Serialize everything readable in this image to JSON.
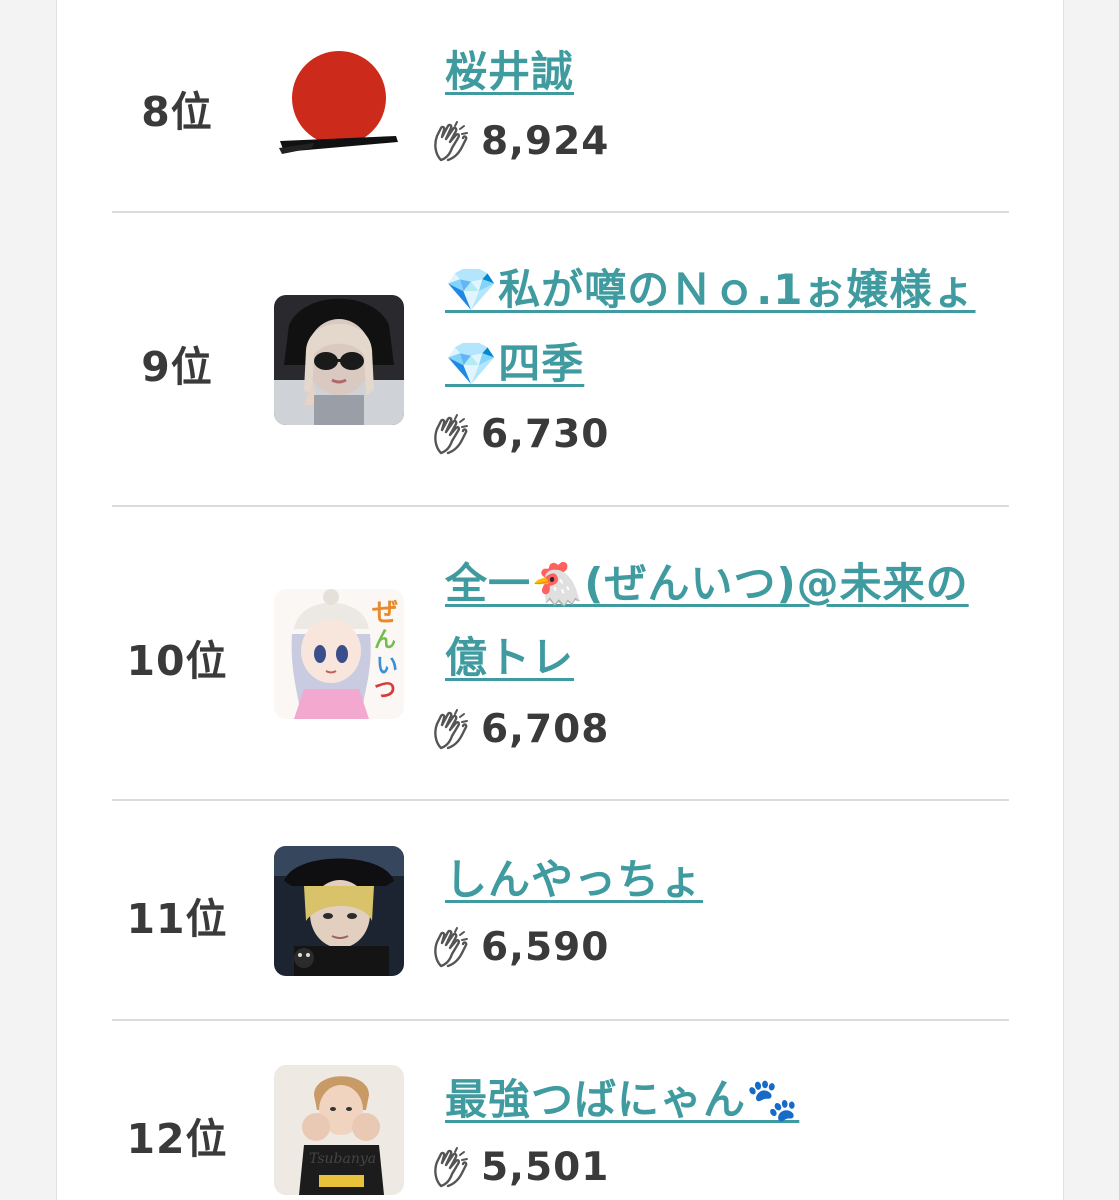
{
  "ranking": {
    "entries": [
      {
        "rank": "8位",
        "name": "桜井誠",
        "claps": "8,924",
        "avatar": "rising-sun-avatar"
      },
      {
        "rank": "9位",
        "name": "💎私が噂のＮｏ.1ぉ嬢様ょ💎四季",
        "claps": "6,730",
        "avatar": "woman-sunglasses-avatar"
      },
      {
        "rank": "10位",
        "name": "全一🐔(ぜんいつ)@未来の億トレ",
        "claps": "6,708",
        "avatar": "anime-girl-avatar"
      },
      {
        "rank": "11位",
        "name": "しんやっちょ",
        "claps": "6,590",
        "avatar": "man-hat-avatar"
      },
      {
        "rank": "12位",
        "name": "最強つばにゃん🐾",
        "claps": "5,501",
        "avatar": "boxer-woman-avatar"
      }
    ]
  },
  "icons": {
    "clap": "clapping-hands-icon"
  },
  "colors": {
    "link": "#3f9b9f",
    "text": "#3a3a3a",
    "divider": "#dcdcdc",
    "background": "#f3f3f3"
  }
}
